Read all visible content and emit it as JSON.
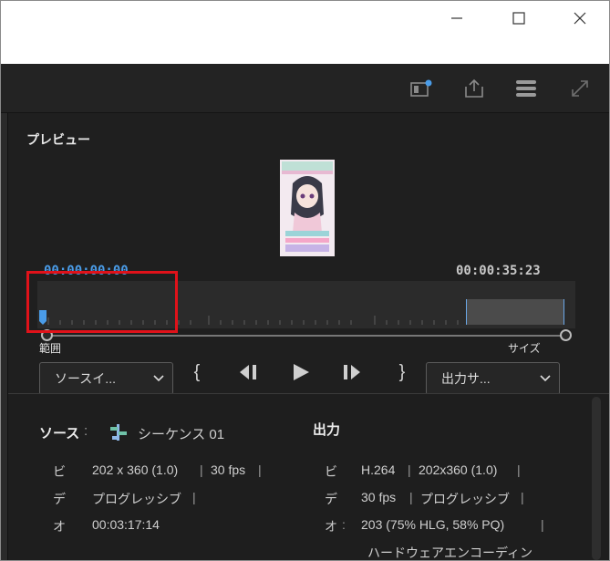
{
  "window": {
    "minimize_icon": "minimize-icon",
    "maximize_icon": "maximize-icon",
    "close_icon": "close-icon"
  },
  "toolbar": {
    "icons": [
      "queue-icon",
      "share-icon",
      "stack-icon",
      "expand-icon"
    ]
  },
  "preview": {
    "title": "プレビュー",
    "timecode_start": "00:00:00:00",
    "timecode_end": "00:00:35:23"
  },
  "controls": {
    "range_label": "範囲",
    "range_value": "ソースイ...",
    "size_label": "サイズ",
    "size_value": "出力サ...",
    "mark_in": "{",
    "step_back": "◀❙",
    "play": "▶",
    "step_forward": "❙▶",
    "mark_out": "}"
  },
  "source": {
    "heading": "ソース",
    "separator": ":",
    "sequence_name": "シーケンス 01",
    "rows": [
      {
        "key": "ビ",
        "value": "202 x 360 (1.0)",
        "sep": "|",
        "extra": "30 fps",
        "sep2": "|"
      },
      {
        "key": "デ",
        "value": "プログレッシブ",
        "sep": "|"
      },
      {
        "key": "オ",
        "value": "00:03:17:14"
      }
    ]
  },
  "output": {
    "heading": "出力",
    "rows": [
      {
        "key": "ビ",
        "value": "H.264",
        "sep": "|",
        "extra": "202x360 (1.0)",
        "sep2": "|"
      },
      {
        "key": "デ",
        "value": "30 fps",
        "sep": "|",
        "extra": "プログレッシブ",
        "sep2": "|"
      },
      {
        "key": "オ",
        "colon": ":",
        "value": "203 (75% HLG, 58% PQ)",
        "sep": "|"
      },
      {
        "value": "ハードウェアエンコーディン"
      }
    ]
  },
  "colors": {
    "accent": "#4a9ce8",
    "highlight": "#e0121a",
    "background": "#1f1f1f"
  }
}
